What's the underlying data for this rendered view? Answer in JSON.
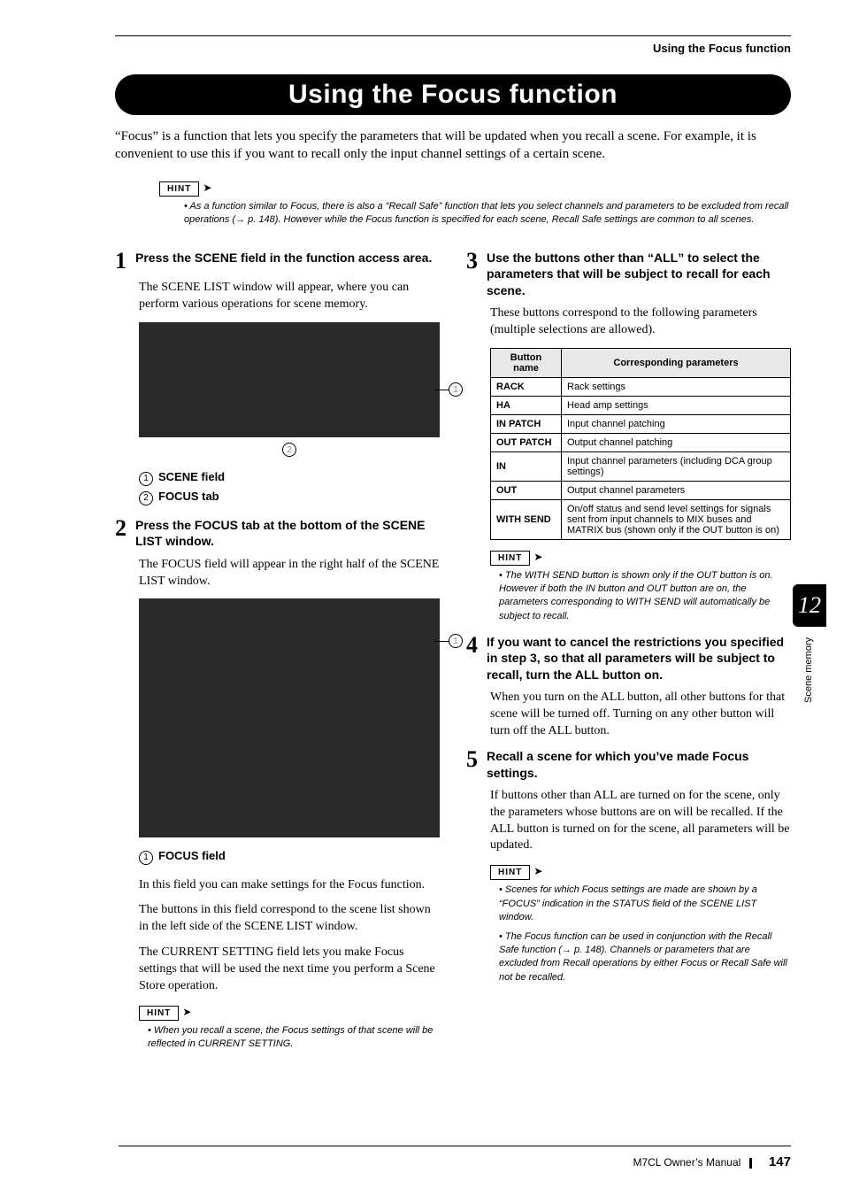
{
  "header": {
    "running_title": "Using the Focus function"
  },
  "title": "Using the Focus function",
  "intro": "“Focus” is a function that lets you specify the parameters that will be updated when you recall a scene. For example, it is convenient to use this if you want to recall only the input channel settings of a certain scene.",
  "top_hint": {
    "label": "HINT",
    "bullets": [
      "As a function similar to Focus, there is also a “Recall Safe” function that lets you select channels and parameters to be excluded from recall operations (→ p. 148). However while the Focus function is specified for each scene, Recall Safe settings are common to all scenes."
    ]
  },
  "left": {
    "step1": {
      "num": "1",
      "head": "Press the SCENE field in the function access area.",
      "body": "The SCENE LIST window will appear, where you can perform various operations for scene memory.",
      "callouts": [
        {
          "n": "1",
          "label": "SCENE field"
        },
        {
          "n": "2",
          "label": "FOCUS tab"
        }
      ]
    },
    "step2": {
      "num": "2",
      "head": "Press the FOCUS tab at the bottom of the SCENE LIST window.",
      "body": "The FOCUS field will appear in the right half of the SCENE LIST window.",
      "callout": {
        "n": "1",
        "label": "FOCUS field"
      },
      "para1": "In this field you can make settings for the Focus function.",
      "para2": "The buttons in this field correspond to the scene list shown in the left side of the SCENE LIST window.",
      "para3": "The CURRENT SETTING field lets you make Focus settings that will be used the next time you perform a Scene Store operation.",
      "hint": {
        "label": "HINT",
        "bullets": [
          "When you recall a scene, the Focus settings of that scene will be reflected in CURRENT SETTING."
        ]
      }
    }
  },
  "right": {
    "step3": {
      "num": "3",
      "head": "Use the buttons other than “ALL” to select the parameters that will be subject to recall for each scene.",
      "body": "These buttons correspond to the following parameters (multiple selections are allowed).",
      "table": {
        "headers": [
          "Button name",
          "Corresponding parameters"
        ],
        "rows": [
          [
            "RACK",
            "Rack settings"
          ],
          [
            "HA",
            "Head amp settings"
          ],
          [
            "IN PATCH",
            "Input channel patching"
          ],
          [
            "OUT PATCH",
            "Output channel patching"
          ],
          [
            "IN",
            "Input channel parameters (including DCA group settings)"
          ],
          [
            "OUT",
            "Output channel parameters"
          ],
          [
            "WITH SEND",
            "On/off status and send level settings for signals sent from input channels to MIX buses and MATRIX bus (shown only if the OUT button is on)"
          ]
        ]
      },
      "hint": {
        "label": "HINT",
        "bullets": [
          "The WITH SEND button is shown only if the OUT button is on. However if both the IN button and OUT button are on, the parameters corresponding to WITH SEND will automatically be subject to recall."
        ]
      }
    },
    "step4": {
      "num": "4",
      "head": "If you want to cancel the restrictions you specified in step 3, so that all parameters will be subject to recall, turn the ALL button on.",
      "body": "When you turn on the ALL button, all other buttons for that scene will be turned off. Turning on any other button will turn off the ALL button."
    },
    "step5": {
      "num": "5",
      "head": "Recall a scene for which you’ve made Focus settings.",
      "body": "If buttons other than ALL are turned on for the scene, only the parameters whose buttons are on will be recalled. If the ALL button is turned on for the scene, all parameters will be updated.",
      "hint": {
        "label": "HINT",
        "bullets": [
          "Scenes for which Focus settings are made are shown by a “FOCUS” indication in the STATUS field of the SCENE LIST window.",
          "The Focus function can be used in conjunction with the Recall Safe function (→ p. 148). Channels or parameters that are excluded from Recall operations by either Focus or Recall Safe will not be recalled."
        ]
      }
    }
  },
  "side_tab": {
    "chapter": "12",
    "label": "Scene memory"
  },
  "footer": {
    "text": "M7CL  Owner’s Manual",
    "page": "147"
  }
}
